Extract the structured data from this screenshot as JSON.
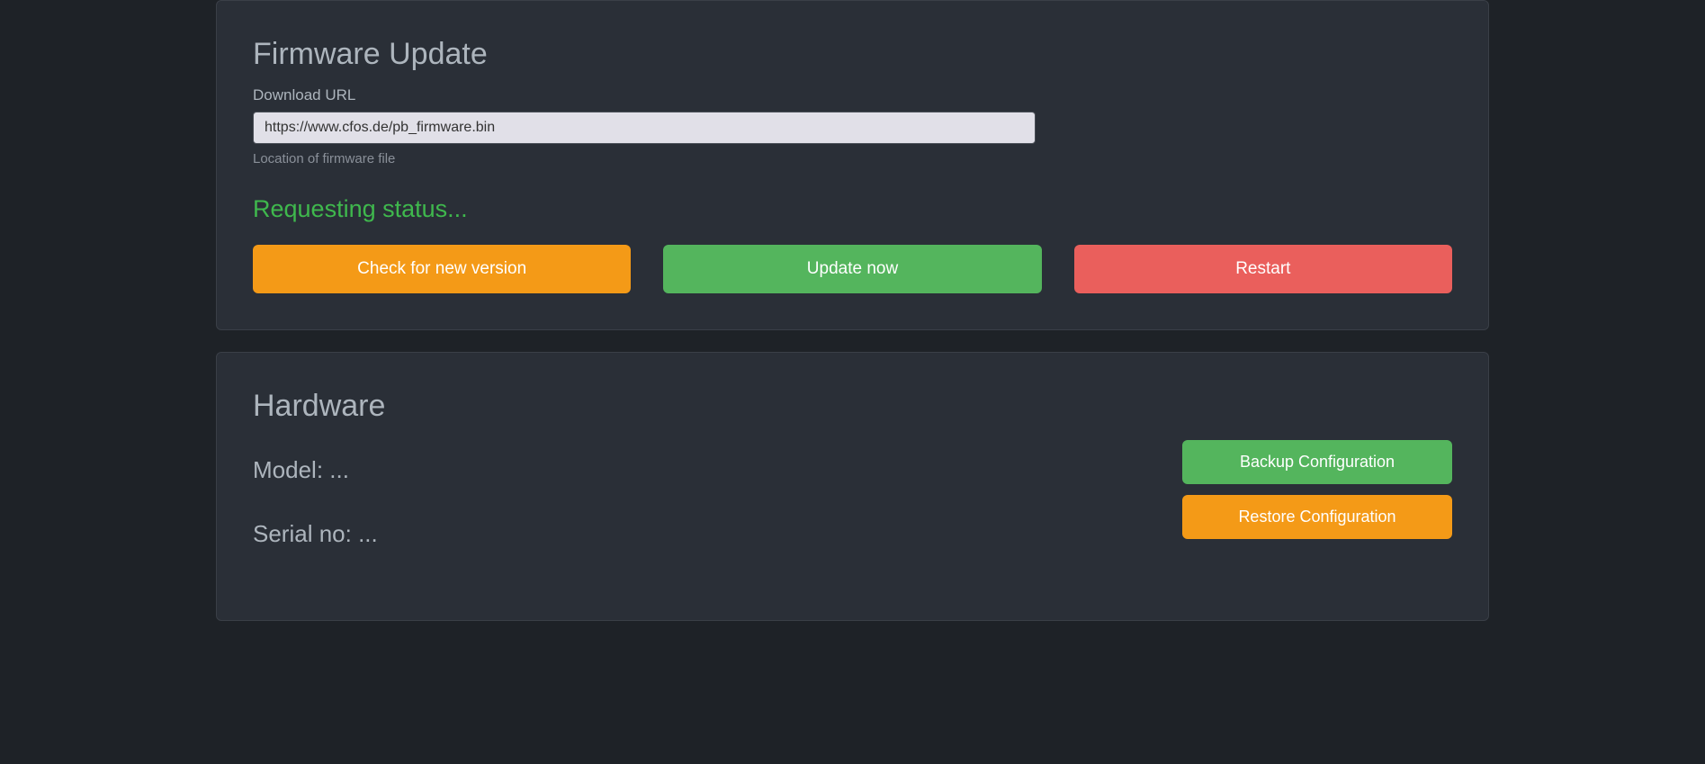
{
  "firmware": {
    "title": "Firmware Update",
    "url_label": "Download URL",
    "url_value": "https://www.cfos.de/pb_firmware.bin",
    "url_help": "Location of firmware file",
    "status": "Requesting status...",
    "check_button": "Check for new version",
    "update_button": "Update now",
    "restart_button": "Restart"
  },
  "hardware": {
    "title": "Hardware",
    "model_label": "Model: ",
    "model_value": "...",
    "serial_label": "Serial no: ",
    "serial_value": "...",
    "backup_button": "Backup Configuration",
    "restore_button": "Restore Configuration"
  }
}
